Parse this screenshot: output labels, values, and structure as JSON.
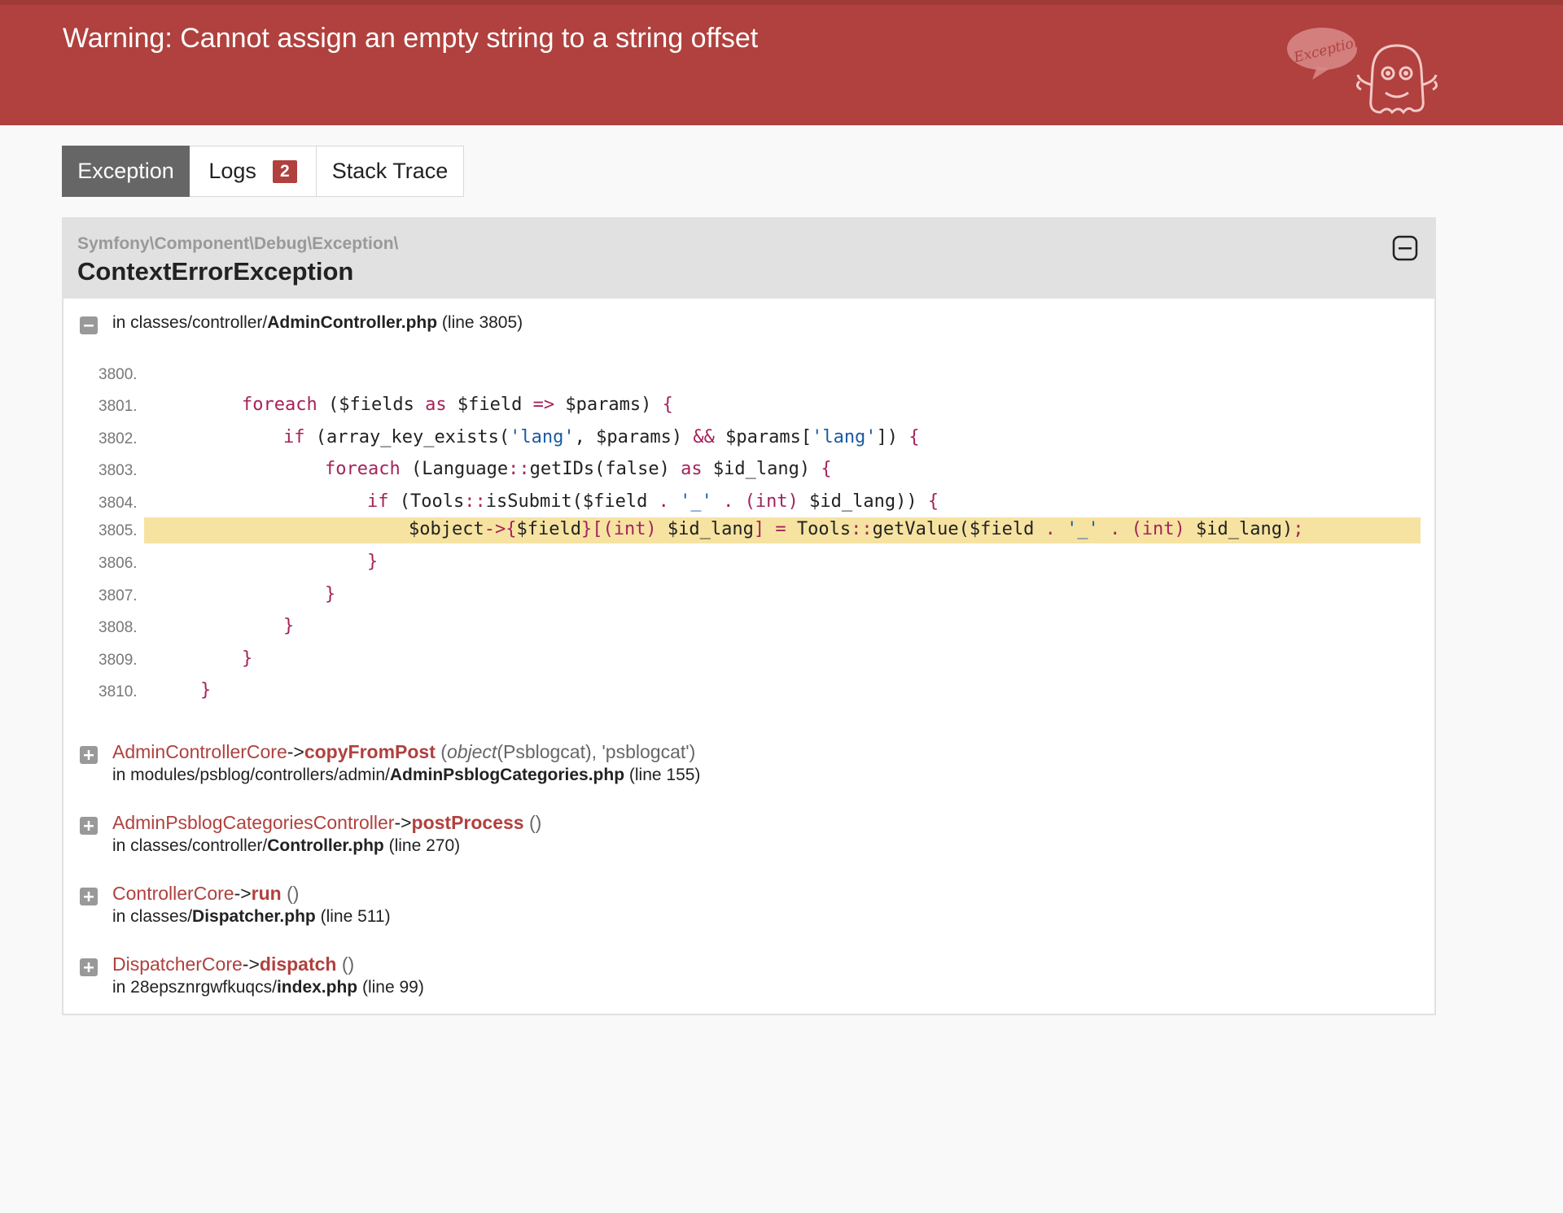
{
  "header": {
    "title": "Warning: Cannot assign an empty string to a string offset",
    "logo_text": "Exception!",
    "bg_color": "#b0413e"
  },
  "tabs": [
    {
      "label": "Exception",
      "active": true
    },
    {
      "label": "Logs",
      "badge": "2"
    },
    {
      "label": "Stack Trace"
    }
  ],
  "exception": {
    "namespace": "Symfony\\Component\\Debug\\Exception\\",
    "class": "ContextErrorException",
    "location_prefix": "in classes/controller/",
    "location_file": "AdminController.php",
    "location_line": "(line 3805)",
    "code_lines": [
      {
        "no": "3800.",
        "text": ""
      },
      {
        "no": "3801.",
        "text": "foreach ($fields as $field => $params) {"
      },
      {
        "no": "3802.",
        "text": "if (array_key_exists('lang', $params) && $params['lang']) {"
      },
      {
        "no": "3803.",
        "text": "foreach (Language::getIDs(false) as $id_lang) {"
      },
      {
        "no": "3804.",
        "text": "if (Tools::isSubmit($field . '_' . (int) $id_lang)) {"
      },
      {
        "no": "3805.",
        "text": "$object->{$field}[(int) $id_lang] = Tools::getValue($field . '_' . (int) $id_lang);",
        "highlight": true
      },
      {
        "no": "3806.",
        "text": "}"
      },
      {
        "no": "3807.",
        "text": "}"
      },
      {
        "no": "3808.",
        "text": "}"
      },
      {
        "no": "3809.",
        "text": "}"
      },
      {
        "no": "3810.",
        "text": "}"
      }
    ]
  },
  "trace": [
    {
      "class": "AdminControllerCore",
      "arrow": "->",
      "method": "copyFromPost",
      "args_open": " (",
      "args_type": "object",
      "args_rest": "(Psblogcat), 'psblogcat')",
      "loc_prefix": "in modules/psblog/controllers/admin/",
      "loc_file": "AdminPsblogCategories.php",
      "loc_line": "(line 155)"
    },
    {
      "class": "AdminPsblogCategoriesController",
      "arrow": "->",
      "method": "postProcess",
      "args_open": " ()",
      "args_type": "",
      "args_rest": "",
      "loc_prefix": "in classes/controller/",
      "loc_file": "Controller.php",
      "loc_line": "(line 270)"
    },
    {
      "class": "ControllerCore",
      "arrow": "->",
      "method": "run",
      "args_open": " ()",
      "args_type": "",
      "args_rest": "",
      "loc_prefix": "in classes/",
      "loc_file": "Dispatcher.php",
      "loc_line": "(line 511)"
    },
    {
      "class": "DispatcherCore",
      "arrow": "->",
      "method": "dispatch",
      "args_open": " ()",
      "args_type": "",
      "args_rest": "",
      "loc_prefix": "in 28epsznrgwfkuqcs/",
      "loc_file": "index.php",
      "loc_line": "(line 99)"
    }
  ]
}
